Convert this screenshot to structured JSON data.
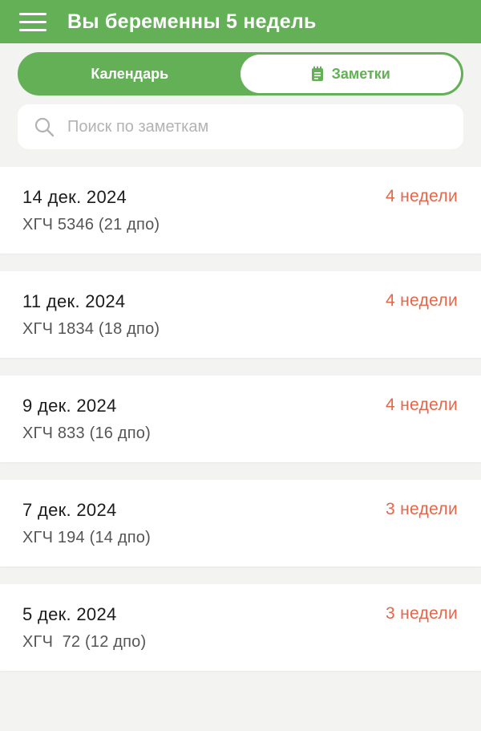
{
  "header": {
    "title": "Вы беременны 5 недель"
  },
  "tabs": {
    "calendar_label": "Календарь",
    "notes_label": "Заметки",
    "active": "notes"
  },
  "search": {
    "placeholder": "Поиск по заметкам"
  },
  "notes": [
    {
      "date": "14 дек. 2024",
      "text": "ХГЧ 5346 (21 дпо)",
      "weeks": "4 недели"
    },
    {
      "date": "11 дек. 2024",
      "text": "ХГЧ 1834 (18 дпо)",
      "weeks": "4 недели"
    },
    {
      "date": "9 дек. 2024",
      "text": "ХГЧ 833 (16 дпо)",
      "weeks": "4 недели"
    },
    {
      "date": "7 дек. 2024",
      "text": "ХГЧ 194 (14 дпо)",
      "weeks": "3 недели"
    },
    {
      "date": "5 дек. 2024",
      "text": "ХГЧ  72 (12 дпо)",
      "weeks": "3 недели"
    }
  ],
  "icons": {
    "menu": "hamburger-menu-icon",
    "notes_tab": "notepad-icon",
    "search": "search-icon"
  },
  "colors": {
    "primary_green": "#64b057",
    "weeks_accent": "#e5664a",
    "background": "#f3f3f1"
  }
}
